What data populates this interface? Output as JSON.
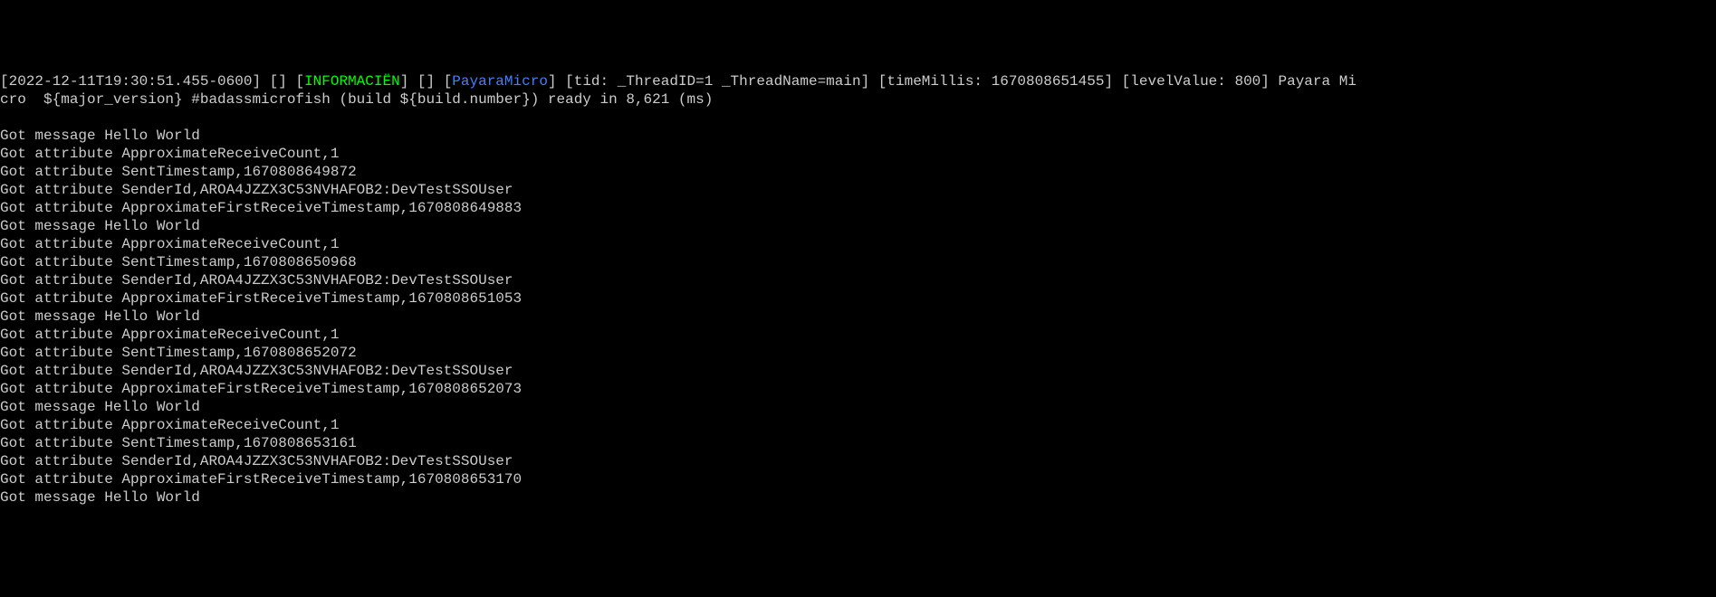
{
  "header": {
    "timestamp": "[2022-12-11T19:30:51.455-0600]",
    "empty1": "[]",
    "level": "INFORMACIËN",
    "empty2": "[]",
    "source": "PayaraMicro",
    "tid": "[tid: _ThreadID=1 _ThreadName=main]",
    "timeMillis": "[timeMillis: 1670808651455]",
    "levelValue": "[levelValue: 800]",
    "message_line1": "Payara Mi",
    "message_line2": "cro  ${major_version} #badassmicrofish (build ${build.number}) ready in 8,621 (ms)"
  },
  "lines": [
    "",
    "Got message Hello World",
    "Got attribute ApproximateReceiveCount,1",
    "Got attribute SentTimestamp,1670808649872",
    "Got attribute SenderId,AROA4JZZX3C53NVHAFOB2:DevTestSSOUser",
    "Got attribute ApproximateFirstReceiveTimestamp,1670808649883",
    "Got message Hello World",
    "Got attribute ApproximateReceiveCount,1",
    "Got attribute SentTimestamp,1670808650968",
    "Got attribute SenderId,AROA4JZZX3C53NVHAFOB2:DevTestSSOUser",
    "Got attribute ApproximateFirstReceiveTimestamp,1670808651053",
    "Got message Hello World",
    "Got attribute ApproximateReceiveCount,1",
    "Got attribute SentTimestamp,1670808652072",
    "Got attribute SenderId,AROA4JZZX3C53NVHAFOB2:DevTestSSOUser",
    "Got attribute ApproximateFirstReceiveTimestamp,1670808652073",
    "Got message Hello World",
    "Got attribute ApproximateReceiveCount,1",
    "Got attribute SentTimestamp,1670808653161",
    "Got attribute SenderId,AROA4JZZX3C53NVHAFOB2:DevTestSSOUser",
    "Got attribute ApproximateFirstReceiveTimestamp,1670808653170",
    "Got message Hello World"
  ]
}
